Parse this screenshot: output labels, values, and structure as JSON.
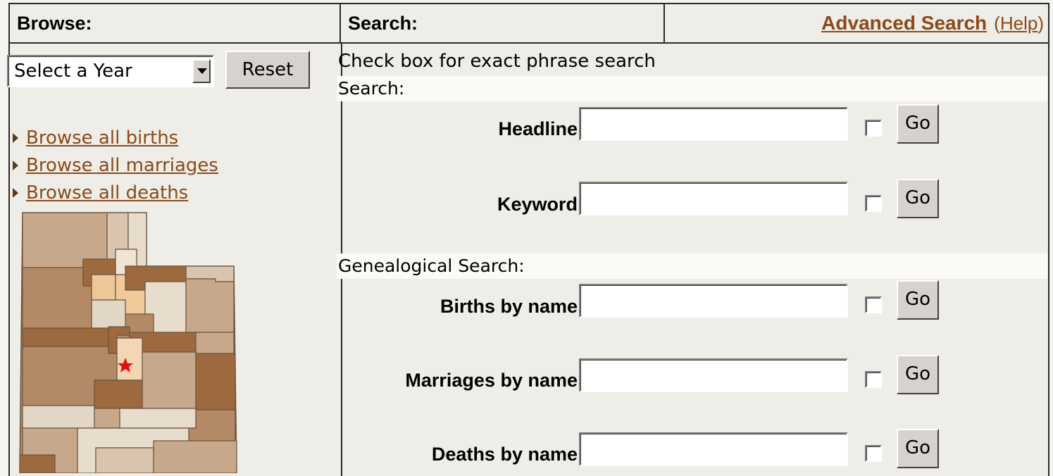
{
  "header": {
    "browse_title": "Browse:",
    "search_title": "Search:",
    "advanced_search_link": "Advanced Search",
    "help_link": "Help",
    "open_paren": "(",
    "close_paren": ")"
  },
  "browse": {
    "year_select_value": "Select a Year",
    "reset_label": "Reset",
    "links": [
      {
        "label": "Browse all births"
      },
      {
        "label": "Browse all marriages"
      },
      {
        "label": "Browse all deaths"
      }
    ],
    "map": {
      "icon": "utah-county-map",
      "marker_icon": "red-star-icon",
      "marker_color": "#e01010"
    }
  },
  "search": {
    "hint": "Check box for exact phrase search",
    "section_title": "Search:",
    "headline_label": "Headline:",
    "keyword_label": "Keyword:",
    "genealogical_title": "Genealogical Search:",
    "births_label": "Births by name:",
    "marriages_label": "Marriages by name:",
    "deaths_label": "Deaths by name:",
    "go_label": "Go"
  },
  "colors": {
    "link": "#8a4a1a",
    "panel_bg": "#efede7",
    "section_bar_bg": "#fbfaf6"
  }
}
